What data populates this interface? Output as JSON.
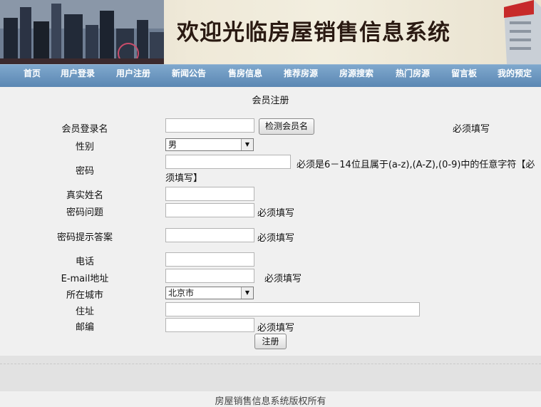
{
  "banner": {
    "title": "欢迎光临房屋销售信息系统"
  },
  "nav": {
    "items": [
      {
        "label": "首页"
      },
      {
        "label": "用户登录"
      },
      {
        "label": "用户注册"
      },
      {
        "label": "新闻公告"
      },
      {
        "label": "售房信息"
      },
      {
        "label": "推荐房源"
      },
      {
        "label": "房源搜索"
      },
      {
        "label": "热门房源"
      },
      {
        "label": "留言板"
      },
      {
        "label": "我的预定"
      }
    ]
  },
  "form": {
    "title": "会员注册",
    "username": {
      "label": "会员登录名",
      "value": "",
      "check_button": "检测会员名",
      "note": "必须填写"
    },
    "gender": {
      "label": "性别",
      "selected": "男"
    },
    "password": {
      "label": "密码",
      "value": "",
      "note_line1": "必须是6－14位且属于(a-z),(A-Z),(0-9)中的任意字符【必",
      "note_line2": "须填写】"
    },
    "realname": {
      "label": "真实姓名",
      "value": ""
    },
    "question": {
      "label": "密码问题",
      "value": "",
      "note": "必须填写"
    },
    "answer": {
      "label": "密码提示答案",
      "value": "",
      "note": "必须填写"
    },
    "phone": {
      "label": "电话",
      "value": ""
    },
    "email": {
      "label": "E-mail地址",
      "value": "",
      "note": "必须填写"
    },
    "city": {
      "label": "所在城市",
      "selected": "北京市"
    },
    "address": {
      "label": "住址",
      "value": ""
    },
    "zip": {
      "label": "邮编",
      "value": "",
      "note": "必须填写"
    },
    "submit": "注册"
  },
  "footer": {
    "copyright": "房屋销售信息系统版权所有"
  },
  "colors": {
    "nav": "#6b96c0",
    "background": "#f0f0f0"
  }
}
